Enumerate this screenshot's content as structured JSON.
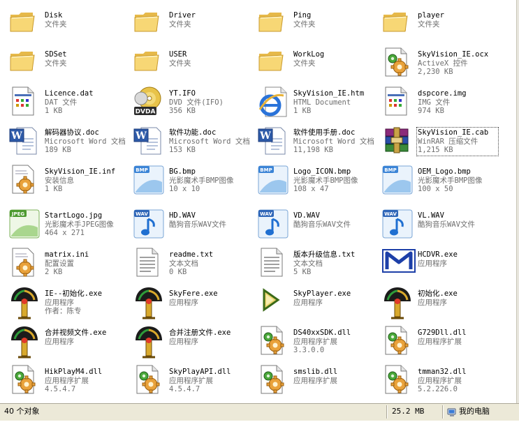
{
  "files": [
    {
      "name": "Disk",
      "line1": "文件夹",
      "line2": "",
      "line3": "",
      "icon": "folder-icon"
    },
    {
      "name": "Driver",
      "line1": "文件夹",
      "line2": "",
      "line3": "",
      "icon": "folder-icon"
    },
    {
      "name": "Ping",
      "line1": "文件夹",
      "line2": "",
      "line3": "",
      "icon": "folder-icon"
    },
    {
      "name": "player",
      "line1": "文件夹",
      "line2": "",
      "line3": "",
      "icon": "folder-icon"
    },
    {
      "name": "SDSet",
      "line1": "文件夹",
      "line2": "",
      "line3": "",
      "icon": "folder-icon"
    },
    {
      "name": "USER",
      "line1": "文件夹",
      "line2": "",
      "line3": "",
      "icon": "folder-icon"
    },
    {
      "name": "WorkLog",
      "line1": "文件夹",
      "line2": "",
      "line3": "",
      "icon": "folder-icon"
    },
    {
      "name": "SkyVision_IE.ocx",
      "line1": "ActiveX 控件",
      "line2": "2,230 KB",
      "line3": "",
      "icon": "dll-file-icon"
    },
    {
      "name": "Licence.dat",
      "line1": "DAT 文件",
      "line2": "1 KB",
      "line3": "",
      "icon": "generic-file-icon"
    },
    {
      "name": "YT.IFO",
      "line1": "DVD 文件(IFO)",
      "line2": "356 KB",
      "line3": "",
      "icon": "dvd-file-icon"
    },
    {
      "name": "SkyVision_IE.htm",
      "line1": "HTML Document",
      "line2": "1 KB",
      "line3": "",
      "icon": "ie-html-icon"
    },
    {
      "name": "dspcore.img",
      "line1": "IMG 文件",
      "line2": "974 KB",
      "line3": "",
      "icon": "generic-file-icon"
    },
    {
      "name": "解码器协议.doc",
      "line1": "Microsoft Word 文档",
      "line2": "189 KB",
      "line3": "",
      "icon": "word-doc-icon"
    },
    {
      "name": "软件功能.doc",
      "line1": "Microsoft Word 文档",
      "line2": "153 KB",
      "line3": "",
      "icon": "word-doc-icon"
    },
    {
      "name": "软件使用手册.doc",
      "line1": "Microsoft Word 文档",
      "line2": "11,198 KB",
      "line3": "",
      "icon": "word-doc-icon"
    },
    {
      "name": "SkyVision_IE.cab",
      "line1": "WinRAR 压缩文件",
      "line2": "1,215 KB",
      "line3": "",
      "icon": "winrar-archive-icon",
      "selected": true
    },
    {
      "name": "SkyVision_IE.inf",
      "line1": "安装信息",
      "line2": "1 KB",
      "line3": "",
      "icon": "settings-file-icon"
    },
    {
      "name": "BG.bmp",
      "line1": "光影魔术手BMP图像",
      "line2": "10 x 10",
      "line3": "",
      "icon": "bmp-image-icon"
    },
    {
      "name": "Logo_ICON.bmp",
      "line1": "光影魔术手BMP图像",
      "line2": "108 x 47",
      "line3": "",
      "icon": "bmp-image-icon"
    },
    {
      "name": "OEM_Logo.bmp",
      "line1": "光影魔术手BMP图像",
      "line2": "100 x 50",
      "line3": "",
      "icon": "bmp-image-icon"
    },
    {
      "name": "StartLogo.jpg",
      "line1": "光影魔术手JPEG图像",
      "line2": "464 x 271",
      "line3": "",
      "icon": "jpeg-image-icon"
    },
    {
      "name": "HD.WAV",
      "line1": "酷狗音乐WAV文件",
      "line2": "",
      "line3": "",
      "icon": "wav-audio-icon"
    },
    {
      "name": "VD.WAV",
      "line1": "酷狗音乐WAV文件",
      "line2": "",
      "line3": "",
      "icon": "wav-audio-icon"
    },
    {
      "name": "VL.WAV",
      "line1": "酷狗音乐WAV文件",
      "line2": "",
      "line3": "",
      "icon": "wav-audio-icon"
    },
    {
      "name": "matrix.ini",
      "line1": "配置设置",
      "line2": "2 KB",
      "line3": "",
      "icon": "settings-file-icon"
    },
    {
      "name": "readme.txt",
      "line1": "文本文档",
      "line2": "0 KB",
      "line3": "",
      "icon": "text-file-icon"
    },
    {
      "name": "版本升级信息.txt",
      "line1": "文本文档",
      "line2": "5 KB",
      "line3": "",
      "icon": "text-file-icon"
    },
    {
      "name": "HCDVR.exe",
      "line1": "应用程序",
      "line2": "",
      "line3": "",
      "icon": "hcdvr-app-icon"
    },
    {
      "name": "IE--初始化.exe",
      "line1": "应用程序",
      "line2": "作者：陈专",
      "line3": "",
      "icon": "torch-app-icon"
    },
    {
      "name": "SkyFere.exe",
      "line1": "应用程序",
      "line2": "",
      "line3": "",
      "icon": "torch-app-icon"
    },
    {
      "name": "SkyPlayer.exe",
      "line1": "应用程序",
      "line2": "",
      "line3": "",
      "icon": "play-arrow-app-icon"
    },
    {
      "name": "初始化.exe",
      "line1": "应用程序",
      "line2": "",
      "line3": "",
      "icon": "torch-app-icon"
    },
    {
      "name": "合并视频文件.exe",
      "line1": "应用程序",
      "line2": "",
      "line3": "",
      "icon": "torch-app-icon"
    },
    {
      "name": "合并注册文件.exe",
      "line1": "应用程序",
      "line2": "",
      "line3": "",
      "icon": "torch-app-icon"
    },
    {
      "name": "DS40xxSDK.dll",
      "line1": "应用程序扩展",
      "line2": "3.3.0.0",
      "line3": "",
      "icon": "dll-file-icon"
    },
    {
      "name": "G729Dll.dll",
      "line1": "应用程序扩展",
      "line2": "",
      "line3": "",
      "icon": "dll-file-icon"
    },
    {
      "name": "HikPlayM4.dll",
      "line1": "应用程序扩展",
      "line2": "4.5.4.7",
      "line3": "",
      "icon": "dll-file-icon"
    },
    {
      "name": "SkyPlayAPI.dll",
      "line1": "应用程序扩展",
      "line2": "4.5.4.7",
      "line3": "",
      "icon": "dll-file-icon"
    },
    {
      "name": "smslib.dll",
      "line1": "应用程序扩展",
      "line2": "",
      "line3": "",
      "icon": "dll-file-icon"
    },
    {
      "name": "tmman32.dll",
      "line1": "应用程序扩展",
      "line2": "5.2.226.0",
      "line3": "",
      "icon": "dll-file-icon"
    }
  ],
  "statusbar": {
    "object_count": "40 个对象",
    "total_size": "25.2 MB",
    "location": "我的电脑",
    "location_icon": "my-computer-icon"
  },
  "colors": {
    "folder": "#f5d56b",
    "window_bg": "#ffffff",
    "statusbar_bg": "#ece9d8",
    "secondary_text": "#6e6e6e"
  }
}
